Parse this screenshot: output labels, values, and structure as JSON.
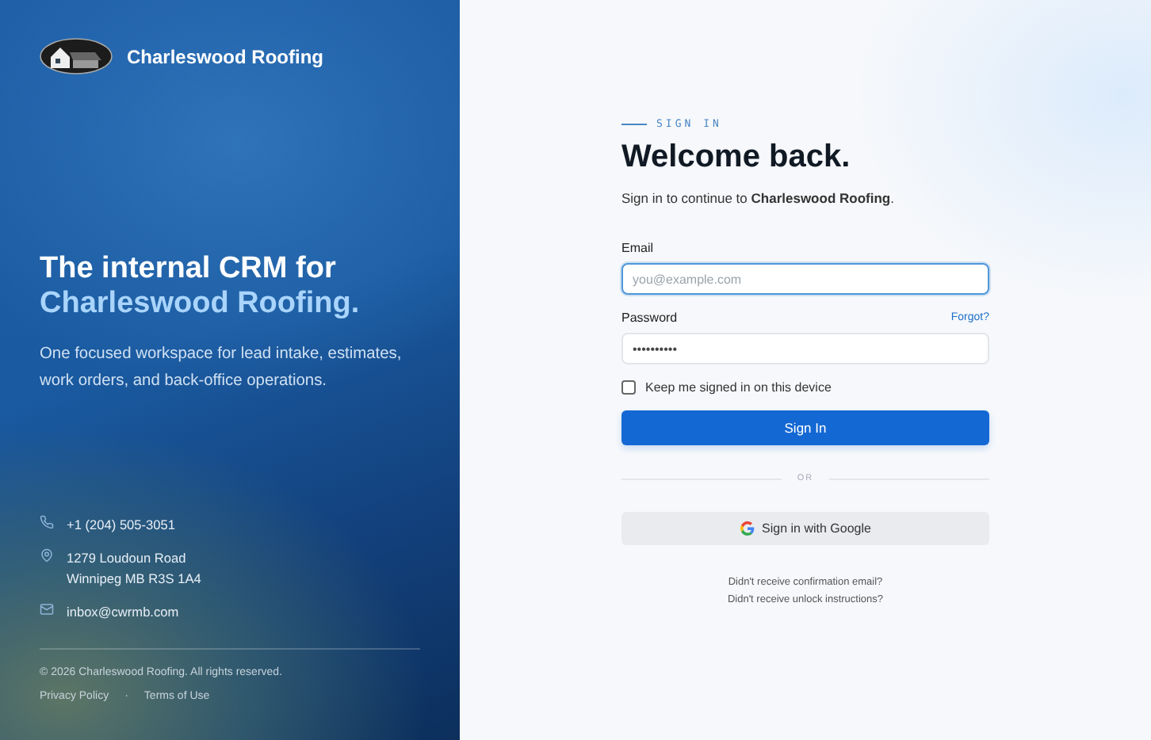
{
  "brand": {
    "name": "Charleswood Roofing"
  },
  "hero": {
    "title_line1": "The internal CRM for",
    "title_line2": "Charleswood Roofing.",
    "subtitle": "One focused workspace for lead intake, estimates, work orders, and back-office operations."
  },
  "contacts": [
    {
      "kind": "phone",
      "lines": [
        "+1 (204) 505-3051"
      ]
    },
    {
      "kind": "address",
      "lines": [
        "1279 Loudoun Road",
        "Winnipeg MB R3S 1A4"
      ]
    },
    {
      "kind": "email",
      "lines": [
        "inbox@cwrmb.com"
      ]
    }
  ],
  "footer": {
    "copyright": "© 2026 Charleswood Roofing. All rights reserved.",
    "links": [
      "Privacy Policy",
      "Terms of Use"
    ],
    "separator": "·"
  },
  "form": {
    "eyebrow": "SIGN IN",
    "title": "Welcome back.",
    "subtitle": "Sign in to continue to **Charleswood Roofing**.",
    "email": {
      "label": "Email",
      "placeholder": "you@example.com",
      "focused": true
    },
    "password": {
      "label": "Password",
      "value": "••••••••••",
      "forgot": "Forgot?",
      "focused": false
    },
    "remember": {
      "label": "Keep me signed in on this device",
      "checked": false
    },
    "submit": "Sign In",
    "divider": "OR",
    "google": "Sign in with Google",
    "help_links": [
      "Didn't receive confirmation email?",
      "Didn't receive unlock instructions?"
    ]
  }
}
